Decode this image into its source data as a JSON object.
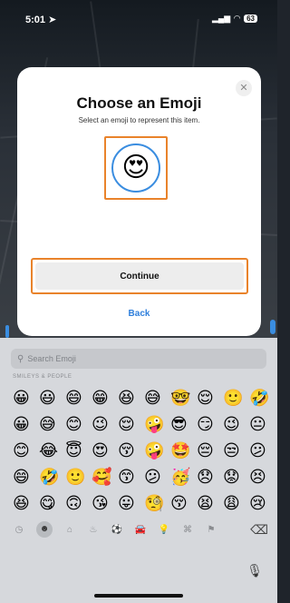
{
  "status_bar": {
    "time": "5:01",
    "location_icon": "location-arrow-icon",
    "battery_level": "63"
  },
  "dialog": {
    "title": "Choose an Emoji",
    "subtitle": "Select an emoji to represent this item.",
    "selected_emoji": "😍",
    "close_icon": "close-icon",
    "continue_label": "Continue",
    "back_label": "Back",
    "highlight_color": "#e9832b",
    "ring_color": "#3a8de0",
    "link_color": "#2f7fdc"
  },
  "keyboard": {
    "search_placeholder": "Search Emoji",
    "category_label": "SMILEYS & PEOPLE",
    "emojis": [
      "😀",
      "😃",
      "😄",
      "😁",
      "😆",
      "😅",
      "🤓",
      "😌",
      "🙂",
      "🤣",
      "😀",
      "😅",
      "😊",
      "😉",
      "😌",
      "🤪",
      "😎",
      "😏",
      "😉",
      "😐",
      "😊",
      "😂",
      "😇",
      "😍",
      "😚",
      "🤪",
      "🤩",
      "😔",
      "😒",
      "😕",
      "😄",
      "🤣",
      "🙂",
      "🥰",
      "😙",
      "😕",
      "🥳",
      "😞",
      "😟",
      "😣",
      "😆",
      "😋",
      "🙃",
      "😘",
      "😛",
      "🧐",
      "😚",
      "😫",
      "😩",
      "😢"
    ],
    "categories": [
      "recent-icon",
      "smiley-icon",
      "animal-icon",
      "food-icon",
      "sports-icon",
      "travel-icon",
      "objects-icon",
      "symbols-icon",
      "flags-icon"
    ],
    "category_glyphs": [
      "◷",
      "☻",
      "⌂",
      "♨",
      "⚽",
      "🚘",
      "💡",
      "⌘",
      "⚑"
    ],
    "delete_icon": "delete-key-icon",
    "mic_icon": "microphone-icon"
  }
}
